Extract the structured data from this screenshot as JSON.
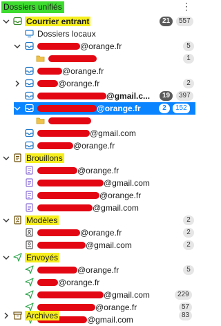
{
  "header": {
    "title": "Dossiers unifiés",
    "menu": "⋮"
  },
  "rows": {
    "inbox": {
      "label": "Courrier entrant",
      "unread": "21",
      "total": "557"
    },
    "local": {
      "label": "Dossiers locaux"
    },
    "a1": {
      "suffix": "@orange.fr",
      "total": "5"
    },
    "a1sub": {
      "total": "1"
    },
    "a2": {
      "suffix": "@orange.fr"
    },
    "a3": {
      "suffix": "@orange.fr",
      "total": "2"
    },
    "a4": {
      "suffix": "@gmail.c...",
      "unread": "19",
      "total": "397"
    },
    "a5": {
      "suffix": "@orange.fr",
      "unread": "2",
      "total": "152"
    },
    "a6": {
      "suffix": "@gmail.com"
    },
    "a7": {
      "suffix": "@orange.fr"
    },
    "drafts": {
      "label": "Brouillons"
    },
    "d1": {
      "suffix": "@orange.fr"
    },
    "d2": {
      "suffix": "@gmail.com"
    },
    "d3": {
      "suffix": "@orange.fr"
    },
    "d4": {
      "suffix": "@gmail.com"
    },
    "templates": {
      "label": "Modèles",
      "total": "2"
    },
    "t1": {
      "suffix": "@orange.fr",
      "total": "2"
    },
    "t2": {
      "suffix": "@gmail.com",
      "total": "2"
    },
    "sent": {
      "label": "Envoyés"
    },
    "s1": {
      "suffix": "@orange.fr",
      "total": "5"
    },
    "s2": {
      "suffix": "@orange.fr"
    },
    "s3": {
      "suffix": "@gmail.com",
      "total": "229"
    },
    "s4": {
      "suffix": "@orange.fr",
      "total": "57"
    },
    "s5": {
      "suffix": "@gmail.com"
    },
    "archives": {
      "label": "Archives",
      "total": "83"
    }
  },
  "colors": {
    "highlight_green": "#3ddc2f",
    "highlight_yellow": "#f7ef1d",
    "redaction": "#e30613",
    "selection": "#0a84ff",
    "icon_blue": "#1f78c8",
    "icon_purple": "#8a6fd6",
    "sent_green": "#2fa84f"
  }
}
